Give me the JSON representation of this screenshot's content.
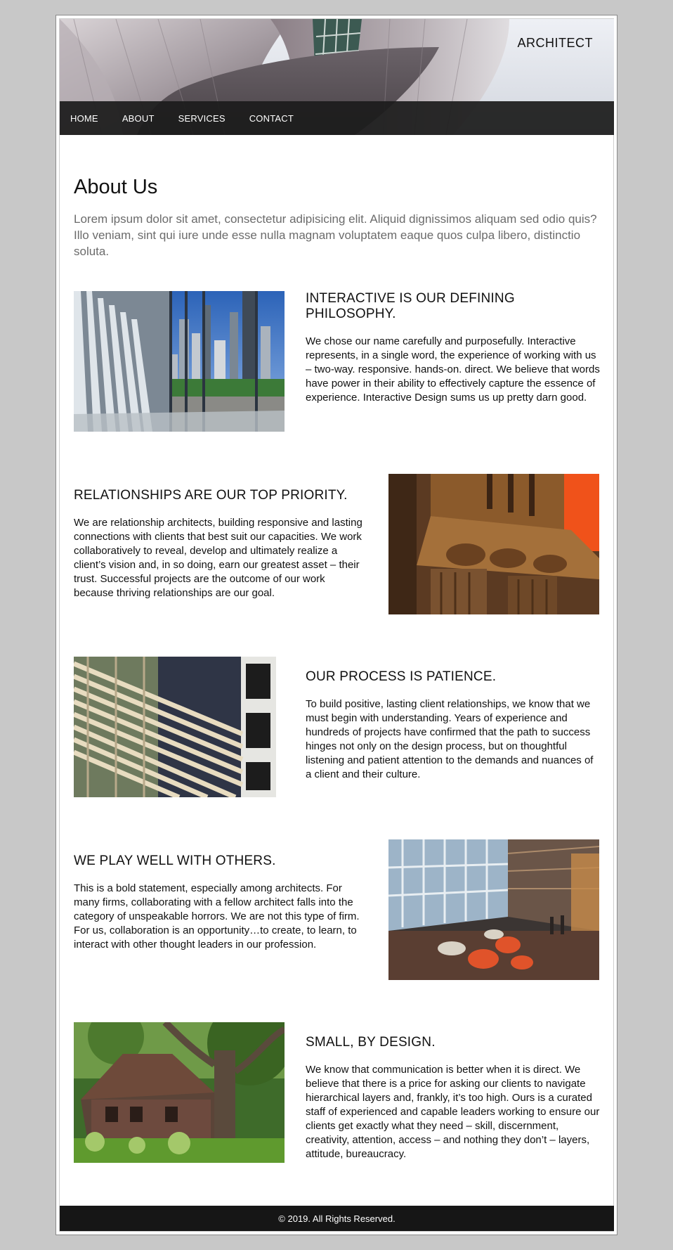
{
  "header": {
    "brand": "ARCHITECT",
    "nav": [
      "HOME",
      "ABOUT",
      "SERVICES",
      "CONTACT"
    ]
  },
  "main": {
    "title": "About Us",
    "intro": "Lorem ipsum dolor sit amet, consectetur adipisicing elit. Aliquid dignissimos aliquam sed odio quis? Illo veniam, sint qui iure unde esse nulla magnam voluptatem eaque quos culpa libero, distinctio soluta.",
    "sections": [
      {
        "title": "INTERACTIVE IS OUR DEFINING PHILOSOPHY.",
        "body": "We chose our name carefully and purposefully. Interactive represents, in a single word, the experience of working with us – two-way. responsive. hands-on. direct. We believe that words have power in their ability to effectively capture the essence of experience. Interactive Design sums us up pretty darn good."
      },
      {
        "title": "RELATIONSHIPS ARE OUR TOP PRIORITY.",
        "body": "We are relationship architects, building responsive and lasting connections with clients that best suit our capacities. We work collaboratively to reveal, develop and ultimately realize a client’s vision and, in so doing, earn our greatest asset – their trust. Successful projects are the outcome of our work because thriving relationships are our goal."
      },
      {
        "title": "OUR PROCESS IS PATIENCE.",
        "body": "To build positive, lasting client relationships, we know that we must begin with understanding. Years of experience and hundreds of projects have confirmed that the path to success hinges not only on the design process, but on thoughtful listening and patient attention to the demands and nuances of a client and their culture."
      },
      {
        "title": "WE PLAY WELL WITH OTHERS.",
        "body": "This is a bold statement, especially among architects. For many firms, collaborating with a fellow architect falls into the category of unspeakable horrors. We are not this type of firm. For us, collaboration is an opportunity…to create, to learn, to interact with other thought leaders in our profession."
      },
      {
        "title": "SMALL, BY DESIGN.",
        "body": "We know that communication is better when it is direct. We believe that there is a price for asking our clients to navigate hierarchical layers and, frankly, it’s too high. Ours is a curated staff of experienced and capable leaders working to ensure our clients get exactly what they need – skill, discernment, creativity, attention, access – and nothing they don’t – layers, attitude, bureaucracy."
      }
    ]
  },
  "footer": {
    "copyright": "© 2019. All Rights Reserved."
  }
}
